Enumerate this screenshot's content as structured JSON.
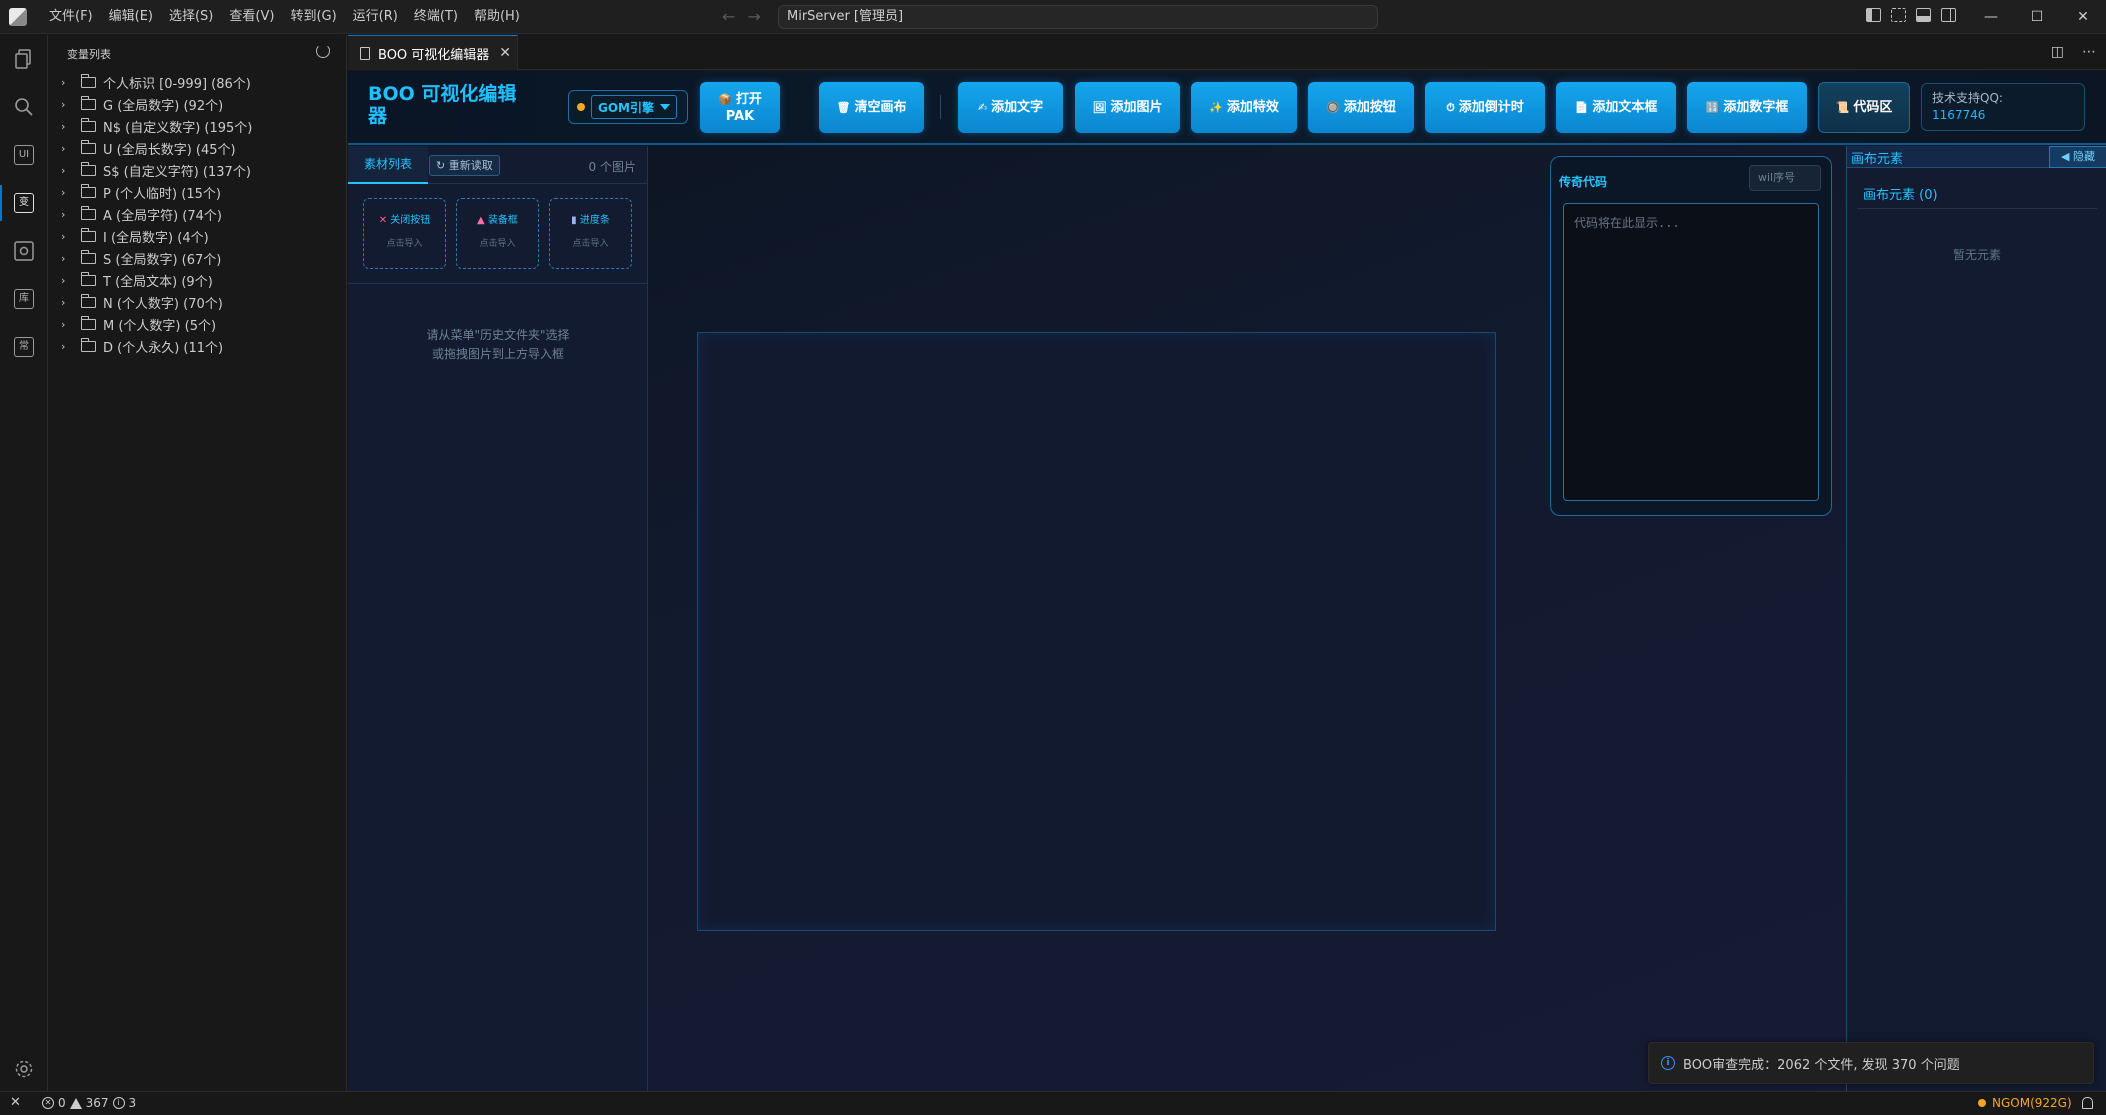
{
  "titlebar": {
    "menu": [
      "文件(F)",
      "编辑(E)",
      "选择(S)",
      "查看(V)",
      "转到(G)",
      "运行(R)",
      "终端(T)",
      "帮助(H)"
    ],
    "command_center": "MirServer [管理员]"
  },
  "sidebar": {
    "title": "变量列表",
    "items": [
      "个人标识 [0-999] (86个)",
      "G (全局数字) (92个)",
      "N$ (自定义数字) (195个)",
      "U (全局长数字) (45个)",
      "S$ (自定义字符) (137个)",
      "P (个人临时) (15个)",
      "A (全局字符) (74个)",
      "I (全局数字) (4个)",
      "S (全局数字) (67个)",
      "T (全局文本) (9个)",
      "N (个人数字) (70个)",
      "M (个人数字) (5个)",
      "D (个人永久) (11个)"
    ]
  },
  "activity": {
    "ui_label": "UI",
    "var_label": "变",
    "lib_label": "库",
    "common_label": "常"
  },
  "tab": {
    "title": "BOO 可视化编辑器"
  },
  "toolbar": {
    "brand": "BOO 可视化编辑器",
    "engine": "GOM引擎",
    "buttons": [
      {
        "icon": "📦",
        "label": "打开PAK"
      },
      {
        "icon": "🗑",
        "label": "清空画布"
      },
      {
        "icon": "✍",
        "label": "添加文字"
      },
      {
        "icon": "🖼",
        "label": "添加图片"
      },
      {
        "icon": "✨",
        "label": "添加特效"
      },
      {
        "icon": "🔘",
        "label": "添加按钮"
      },
      {
        "icon": "⏱",
        "label": "添加倒计时"
      },
      {
        "icon": "📄",
        "label": "添加文本框"
      },
      {
        "icon": "🔢",
        "label": "添加数字框"
      },
      {
        "icon": "📜",
        "label": "代码区"
      }
    ],
    "support_label": "技术支持QQ:",
    "support_qq": "1167746"
  },
  "materials": {
    "tab": "素材列表",
    "reload": "↻ 重新读取",
    "count": "0 个图片",
    "slots": [
      {
        "title": "关闭按钮",
        "sub": "点击导入"
      },
      {
        "title": "装备框",
        "sub": "点击导入"
      },
      {
        "title": "进度条",
        "sub": "点击导入"
      }
    ],
    "hint_line1": "请从菜单\"历史文件夹\"选择",
    "hint_line2": "或拖拽图片到上方导入框"
  },
  "code_panel": {
    "title": "传奇代码",
    "input_placeholder": "wil序号",
    "area_placeholder": "代码将在此显示..."
  },
  "elements_panel": {
    "title": "画布元素",
    "hide": "◀ 隐藏",
    "count": "画布元素 (0)",
    "empty": "暂无元素"
  },
  "toast": {
    "message": "BOO审查完成：2062 个文件, 发现 370 个问题"
  },
  "statusbar": {
    "errors": "0",
    "warnings": "367",
    "infos": "3",
    "engine_status": "NGOM(922G)"
  },
  "colors": {
    "accent": "#25c4ff",
    "button": "#0b86cf",
    "vscode_blue": "#0078d4",
    "warning": "#f5a623"
  }
}
